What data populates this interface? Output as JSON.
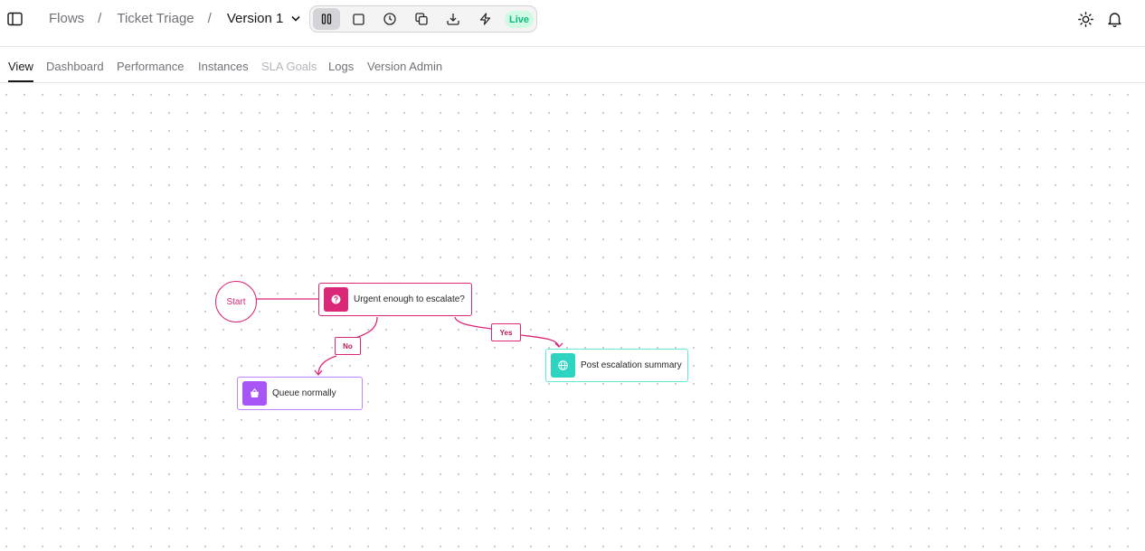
{
  "breadcrumb": {
    "items": [
      "Flows",
      "Ticket Triage"
    ],
    "separator": "/",
    "current": "Version 1"
  },
  "toolbar": {
    "buttons": [
      "pause-icon",
      "stop-icon",
      "clock-icon",
      "copy-icon",
      "download-icon",
      "lightning-icon"
    ],
    "active": "pause-icon",
    "status_badge": "Live"
  },
  "header_icons": [
    "sun-icon",
    "bell-icon"
  ],
  "tabs": [
    {
      "label": "View",
      "state": "active"
    },
    {
      "label": "Dashboard",
      "state": "normal"
    },
    {
      "label": "Performance",
      "state": "normal"
    },
    {
      "label": "Instances",
      "state": "normal"
    },
    {
      "label": "SLA Goals",
      "state": "disabled"
    },
    {
      "label": "Logs",
      "state": "normal"
    },
    {
      "label": "Version Admin",
      "state": "normal"
    }
  ],
  "flow": {
    "start": {
      "label": "Start"
    },
    "decision": {
      "label": "Urgent enough to escalate?",
      "icon": "question-icon",
      "color": "#db2777"
    },
    "queue": {
      "label": "Queue normally",
      "icon": "basket-icon",
      "color": "#a855f7"
    },
    "post": {
      "label": "Post escalation summary",
      "icon": "globe-icon",
      "color": "#2dd4bf"
    },
    "edges": [
      {
        "label": "No",
        "from": "decision",
        "to": "queue"
      },
      {
        "label": "Yes",
        "from": "decision",
        "to": "post"
      }
    ]
  },
  "colors": {
    "accent": "#db2777",
    "live_bg": "#d1fae5",
    "live_text": "#10b981",
    "canvas_dot": "#c7c7cc"
  }
}
